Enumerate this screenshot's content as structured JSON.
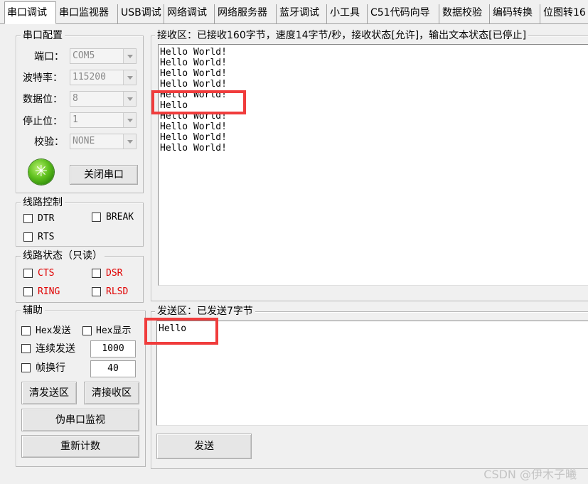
{
  "tabs": [
    "串口调试",
    "串口监视器",
    "USB调试",
    "网络调试",
    "网络服务器",
    "蓝牙调试",
    "小工具",
    "C51代码向导",
    "数据校验",
    "编码转换",
    "位图转16"
  ],
  "serial_config": {
    "legend": "串口配置",
    "port_label": "端口：",
    "port_value": "COM5",
    "baud_label": "波特率：",
    "baud_value": "115200",
    "databits_label": "数据位：",
    "databits_value": "8",
    "stopbits_label": "停止位：",
    "stopbits_value": "1",
    "parity_label": "校验：",
    "parity_value": "NONE",
    "led_glyph": "✳",
    "close_button": "关闭串口"
  },
  "line_control": {
    "legend": "线路控制",
    "dtr": "DTR",
    "break": "BREAK",
    "rts": "RTS"
  },
  "line_status": {
    "legend": "线路状态（只读）",
    "cts": "CTS",
    "dsr": "DSR",
    "ring": "RING",
    "rlsd": "RLSD"
  },
  "aux": {
    "legend": "辅助",
    "hex_send": "Hex发送",
    "hex_display": "Hex显示",
    "continuous_send": "连续发送",
    "continuous_interval": "1000",
    "frame_newline": "帧换行",
    "frame_value": "40",
    "clear_send": "清发送区",
    "clear_receive": "清接收区",
    "pseudo_monitor": "伪串口监视",
    "reset_count": "重新计数"
  },
  "receive": {
    "legend": "接收区：已接收160字节，速度14字节/秒，接收状态[允许]，输出文本状态[已停止]",
    "lines": [
      "Hello World!",
      "Hello World!",
      "Hello World!",
      "Hello World!",
      "Hello World!",
      "Hello",
      "Hello World!",
      "Hello World!",
      "Hello World!",
      "Hello World!"
    ]
  },
  "send": {
    "legend": "发送区：已发送7字节",
    "content": "Hello",
    "send_button": "发送"
  },
  "watermark": "CSDN @伊木子曦",
  "colors": {
    "highlight_box": "#f03c3c",
    "status_red": "#e00000"
  }
}
